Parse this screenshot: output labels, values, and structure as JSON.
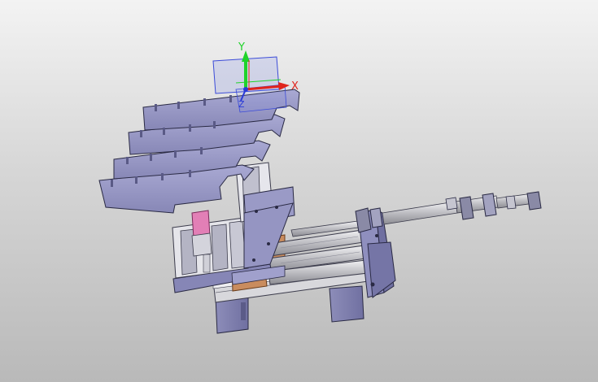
{
  "viewport": {
    "background_top": "#f3f3f3",
    "background_bottom": "#b9b9b9"
  },
  "triad": {
    "x_label": "X",
    "y_label": "Y",
    "z_label": "Z",
    "x_color": "#e0241c",
    "y_color": "#1fd32a",
    "z_color": "#2a3bd8",
    "plane_color": "#3b4bd8"
  },
  "model": {
    "part_fill": "#9b9bc6",
    "part_stroke": "#2a2a44",
    "rod_fill": "#d9d9dc",
    "copper_fill": "#c98c5e",
    "pink_fill": "#e27fb6",
    "gear_fill": "#7c7cae"
  }
}
